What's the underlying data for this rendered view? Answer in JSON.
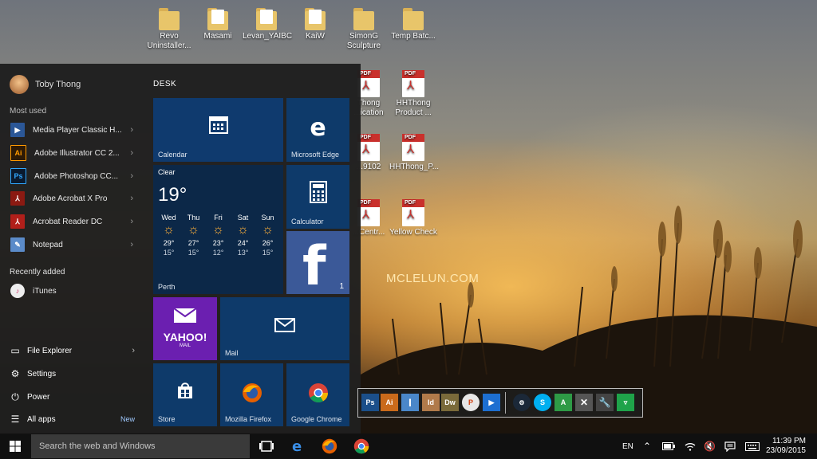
{
  "desktop": {
    "watermark": "MCLELUN.COM",
    "icons": [
      {
        "label": "Revo Uninstaller...",
        "type": "folder"
      },
      {
        "label": "Masami",
        "type": "folder"
      },
      {
        "label": "Levan_YAIBC",
        "type": "folder"
      },
      {
        "label": "KaiW",
        "type": "folder"
      },
      {
        "label": "SimonG Sculpture",
        "type": "folder"
      },
      {
        "label": "Temp Batc...",
        "type": "folder"
      },
      {
        "label": "Thong ...ication",
        "type": "pdf"
      },
      {
        "label": "HHThong Product ...",
        "type": "pdf"
      },
      {
        "label": "...9102",
        "type": "pdf"
      },
      {
        "label": "HHThong_P...",
        "type": "pdf"
      },
      {
        "label": "...Centr...",
        "type": "pdf"
      },
      {
        "label": "Yellow Check",
        "type": "pdf"
      }
    ]
  },
  "start_menu": {
    "user_name": "Toby Thong",
    "most_used_header": "Most used",
    "most_used": [
      {
        "label": "Media Player Classic H...",
        "icon": "media-player-icon",
        "has_arrow": true
      },
      {
        "label": "Adobe Illustrator CC 2...",
        "icon": "illustrator-icon",
        "has_arrow": true
      },
      {
        "label": "Adobe Photoshop CC...",
        "icon": "photoshop-icon",
        "has_arrow": true
      },
      {
        "label": "Adobe Acrobat X Pro",
        "icon": "acrobat-icon",
        "has_arrow": true
      },
      {
        "label": "Acrobat Reader DC",
        "icon": "acrobat-reader-icon",
        "has_arrow": true
      },
      {
        "label": "Notepad",
        "icon": "notepad-icon",
        "has_arrow": true
      }
    ],
    "recently_added_header": "Recently added",
    "recently_added": [
      {
        "label": "iTunes",
        "icon": "itunes-icon"
      }
    ],
    "system_items": {
      "file_explorer": "File Explorer",
      "settings": "Settings",
      "power": "Power",
      "all_apps": "All apps",
      "new_badge": "New"
    },
    "tile_group": "DESK",
    "tiles": {
      "calendar": "Calendar",
      "edge": "Microsoft Edge",
      "calculator": "Calculator",
      "facebook_count": "1",
      "mail": "Mail",
      "yahoo": "YAHOO!",
      "yahoo_sub": "MAIL",
      "store": "Store",
      "firefox": "Mozilla Firefox",
      "chrome": "Google Chrome"
    },
    "weather": {
      "condition": "Clear",
      "temperature": "19°",
      "location": "Perth",
      "days": [
        {
          "day": "Wed",
          "high": "29°",
          "low": "15°"
        },
        {
          "day": "Thu",
          "high": "27°",
          "low": "15°"
        },
        {
          "day": "Fri",
          "high": "23°",
          "low": "12°"
        },
        {
          "day": "Sat",
          "high": "24°",
          "low": "13°"
        },
        {
          "day": "Sun",
          "high": "26°",
          "low": "15°"
        }
      ]
    }
  },
  "taskbar": {
    "search_placeholder": "Search the web and Windows",
    "language": "EN",
    "time": "11:39 PM",
    "date": "23/09/2015"
  },
  "dock": {
    "items": [
      "Ps",
      "Ai",
      "I",
      "Id",
      "Dw",
      "P",
      "▶",
      "steam",
      "S",
      "A",
      "tools",
      "wrench",
      "trash"
    ]
  }
}
